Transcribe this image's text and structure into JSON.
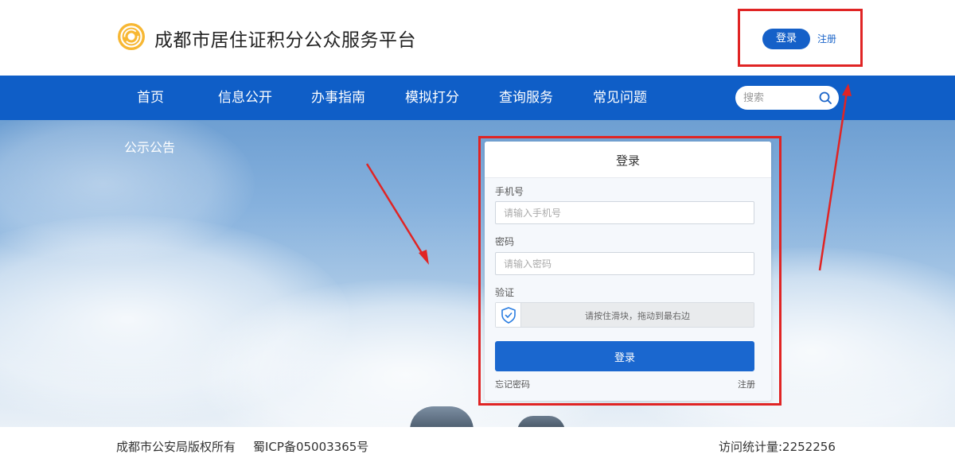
{
  "header": {
    "site_title": "成都市居住证积分公众服务平台",
    "login_label": "登录",
    "register_label": "注册"
  },
  "nav": {
    "items": [
      {
        "label": "首页"
      },
      {
        "label": "信息公开"
      },
      {
        "label": "办事指南"
      },
      {
        "label": "模拟打分"
      },
      {
        "label": "查询服务"
      },
      {
        "label": "常见问题"
      }
    ],
    "search_placeholder": "搜索"
  },
  "hero": {
    "notice_label": "公示公告"
  },
  "login_panel": {
    "title": "登录",
    "phone_label": "手机号",
    "phone_placeholder": "请输入手机号",
    "password_label": "密码",
    "password_placeholder": "请输入密码",
    "captcha_label": "验证",
    "captcha_text": "请按住滑块，拖动到最右边",
    "submit_label": "登录",
    "forgot_label": "忘记密码",
    "register_label": "注册"
  },
  "footer": {
    "copyright": "成都市公安局版权所有",
    "icp": "蜀ICP备05003365号",
    "visits": "访问统计量:2252256"
  },
  "colors": {
    "nav_blue": "#0f5ec7",
    "button_blue": "#1a67cf",
    "annotation_red": "#e02424",
    "logo_orange": "#f2a324"
  }
}
